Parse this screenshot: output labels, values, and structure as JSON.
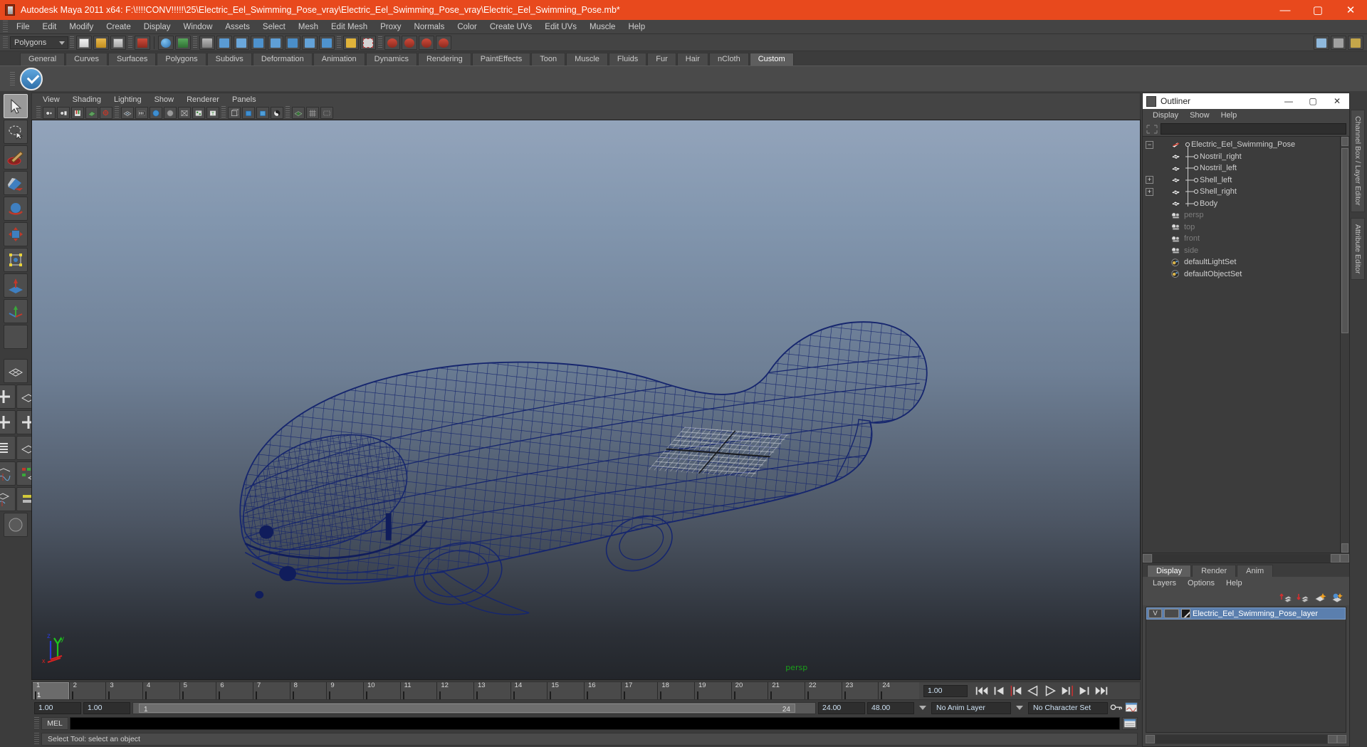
{
  "window": {
    "title": "Autodesk Maya 2011 x64: F:\\!!!!CONV!!!!!\\25\\Electric_Eel_Swimming_Pose_vray\\Electric_Eel_Swimming_Pose_vray\\Electric_Eel_Swimming_Pose.mb*",
    "minimize": "—",
    "maximize": "▢",
    "close": "✕",
    "accent_color": "#e8491d"
  },
  "menubar": {
    "items": [
      "File",
      "Edit",
      "Modify",
      "Create",
      "Display",
      "Window",
      "Assets",
      "Select",
      "Mesh",
      "Edit Mesh",
      "Proxy",
      "Normals",
      "Color",
      "Create UVs",
      "Edit UVs",
      "Muscle",
      "Help"
    ]
  },
  "statusline": {
    "mode_selector": "Polygons"
  },
  "shelf": {
    "tabs": [
      "General",
      "Curves",
      "Surfaces",
      "Polygons",
      "Subdivs",
      "Deformation",
      "Animation",
      "Dynamics",
      "Rendering",
      "PaintEffects",
      "Toon",
      "Muscle",
      "Fluids",
      "Fur",
      "Hair",
      "nCloth",
      "Custom"
    ],
    "active_tab": "Custom"
  },
  "viewport": {
    "menus": [
      "View",
      "Shading",
      "Lighting",
      "Show",
      "Renderer",
      "Panels"
    ],
    "camera_label": "persp",
    "axis": {
      "x": "x",
      "y": "y",
      "z": "z"
    },
    "wireframe_color": "#1b2d7a",
    "background_top": "#93a4bb",
    "background_bottom": "#23262b"
  },
  "outliner": {
    "title": "Outliner",
    "minimize": "—",
    "maximize": "▢",
    "close": "✕",
    "menus": [
      "Display",
      "Show",
      "Help"
    ],
    "search_value": "",
    "items": [
      {
        "label": "Electric_Eel_Swimming_Pose",
        "indent": 0,
        "expander": "−",
        "icon": "transform-icon",
        "dim": false
      },
      {
        "label": "Nostril_right",
        "indent": 1,
        "expander": "",
        "icon": "mesh-icon",
        "dim": false
      },
      {
        "label": "Nostril_left",
        "indent": 1,
        "expander": "",
        "icon": "mesh-icon",
        "dim": false
      },
      {
        "label": "Shell_left",
        "indent": 1,
        "expander": "+",
        "icon": "mesh-icon",
        "dim": false
      },
      {
        "label": "Shell_right",
        "indent": 1,
        "expander": "+",
        "icon": "mesh-icon",
        "dim": false
      },
      {
        "label": "Body",
        "indent": 1,
        "expander": "",
        "icon": "mesh-icon",
        "dim": false
      },
      {
        "label": "persp",
        "indent": 0,
        "expander": "",
        "icon": "camera-icon",
        "dim": true
      },
      {
        "label": "top",
        "indent": 0,
        "expander": "",
        "icon": "camera-icon",
        "dim": true
      },
      {
        "label": "front",
        "indent": 0,
        "expander": "",
        "icon": "camera-icon",
        "dim": true
      },
      {
        "label": "side",
        "indent": 0,
        "expander": "",
        "icon": "camera-icon",
        "dim": true
      },
      {
        "label": "defaultLightSet",
        "indent": 0,
        "expander": "",
        "icon": "set-icon",
        "dim": false
      },
      {
        "label": "defaultObjectSet",
        "indent": 0,
        "expander": "",
        "icon": "set-icon",
        "dim": false
      }
    ]
  },
  "layer_editor": {
    "tabs": [
      "Display",
      "Render",
      "Anim"
    ],
    "active_tab": "Display",
    "menus": [
      "Layers",
      "Options",
      "Help"
    ],
    "layers": [
      {
        "visibility": "V",
        "playback": "",
        "name": "Electric_Eel_Swimming_Pose_layer",
        "selected": true
      }
    ]
  },
  "right_tabs": [
    "Channel Box / Layer Editor",
    "Attribute Editor"
  ],
  "timeline": {
    "frames": [
      "1",
      "2",
      "3",
      "4",
      "5",
      "6",
      "7",
      "8",
      "9",
      "10",
      "11",
      "12",
      "13",
      "14",
      "15",
      "16",
      "17",
      "18",
      "19",
      "20",
      "21",
      "22",
      "23",
      "24"
    ],
    "current_frame": "1",
    "current_frame_field": "1.00"
  },
  "range_slider": {
    "start": "1.00",
    "end": "1.00",
    "range_start_label": "1",
    "range_end_label": "24",
    "playback_end": "24.00",
    "animation_end": "48.00",
    "anim_layer": "No Anim Layer",
    "character_set": "No Character Set"
  },
  "command_line": {
    "language": "MEL",
    "value": ""
  },
  "help_line": {
    "message": "Select Tool: select an object"
  }
}
